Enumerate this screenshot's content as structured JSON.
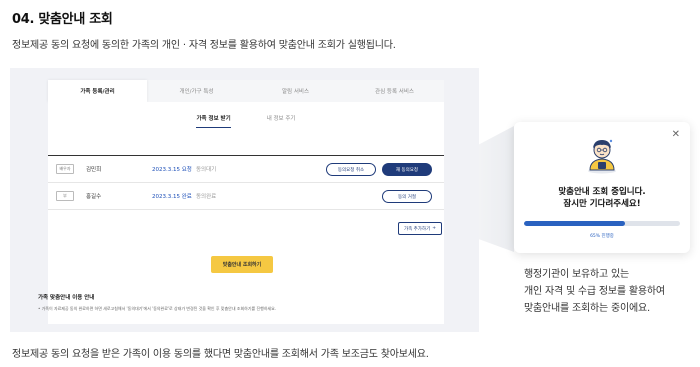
{
  "step": {
    "title": "04. 맞춤안내 조회",
    "description": "정보제공 동의 요청에 동의한 가족의 개인 · 자격 정보를 활용하여 맞춤안내 조회가 실행됩니다."
  },
  "screen": {
    "tabs": [
      {
        "label": "가족 등록/관리"
      },
      {
        "label": "개인/가구 특성"
      },
      {
        "label": "알림 서비스"
      },
      {
        "label": "관심 등록 서비스"
      }
    ],
    "subtabs": [
      {
        "label": "가족 정보 받기"
      },
      {
        "label": "내 정보 주기"
      }
    ],
    "rows": [
      {
        "badge": "배우자",
        "name": "김민희",
        "date": "2023.3.15 요청",
        "status": "동의대기",
        "btn_cancel": "동의요청 취소",
        "btn_rerequest": "재 동의요청"
      },
      {
        "badge": "부",
        "name": "홍길수",
        "date": "2023.3.15 완료",
        "status": "동의완료",
        "btn_revoke": "동의 거절"
      }
    ],
    "add_family_label": "가족 추가하기",
    "lookup_button": "맞춤안내 조회하기",
    "notice": {
      "title": "가족 맞춤안내 이용 안내",
      "text": "• 가족이 자료제공 동의 완료하면 하면 새로고침해서 '동의대기'에서 '동의완료'로 상태가 변경된 것을 확인 후 맞춤안내 조회하기를 진행하세요."
    }
  },
  "modal": {
    "close_icon": "close-icon",
    "title_line1": "맞춤안내 조회 중입니다.",
    "title_line2": "잠시만 기다려주세요!",
    "progress_text": "65% 진행중",
    "progress": 0.65
  },
  "side_caption": {
    "line1": "행정기관이 보유하고 있는",
    "line2": "개인 자격 및 수급 정보를 활용하여",
    "line3": "맞춤안내를 조회하는 중이에요."
  },
  "bottom_text": "정보제공 동의 요청을 받은 가족이 이용 동의를 했다면 맞춤안내를 조회해서 가족 보조금도 찾아보세요.",
  "colors": {
    "primary": "#1f3b7a",
    "accent_yellow": "#f5c842",
    "progress": "#2a62c0",
    "link_blue": "#1d4fb8"
  }
}
